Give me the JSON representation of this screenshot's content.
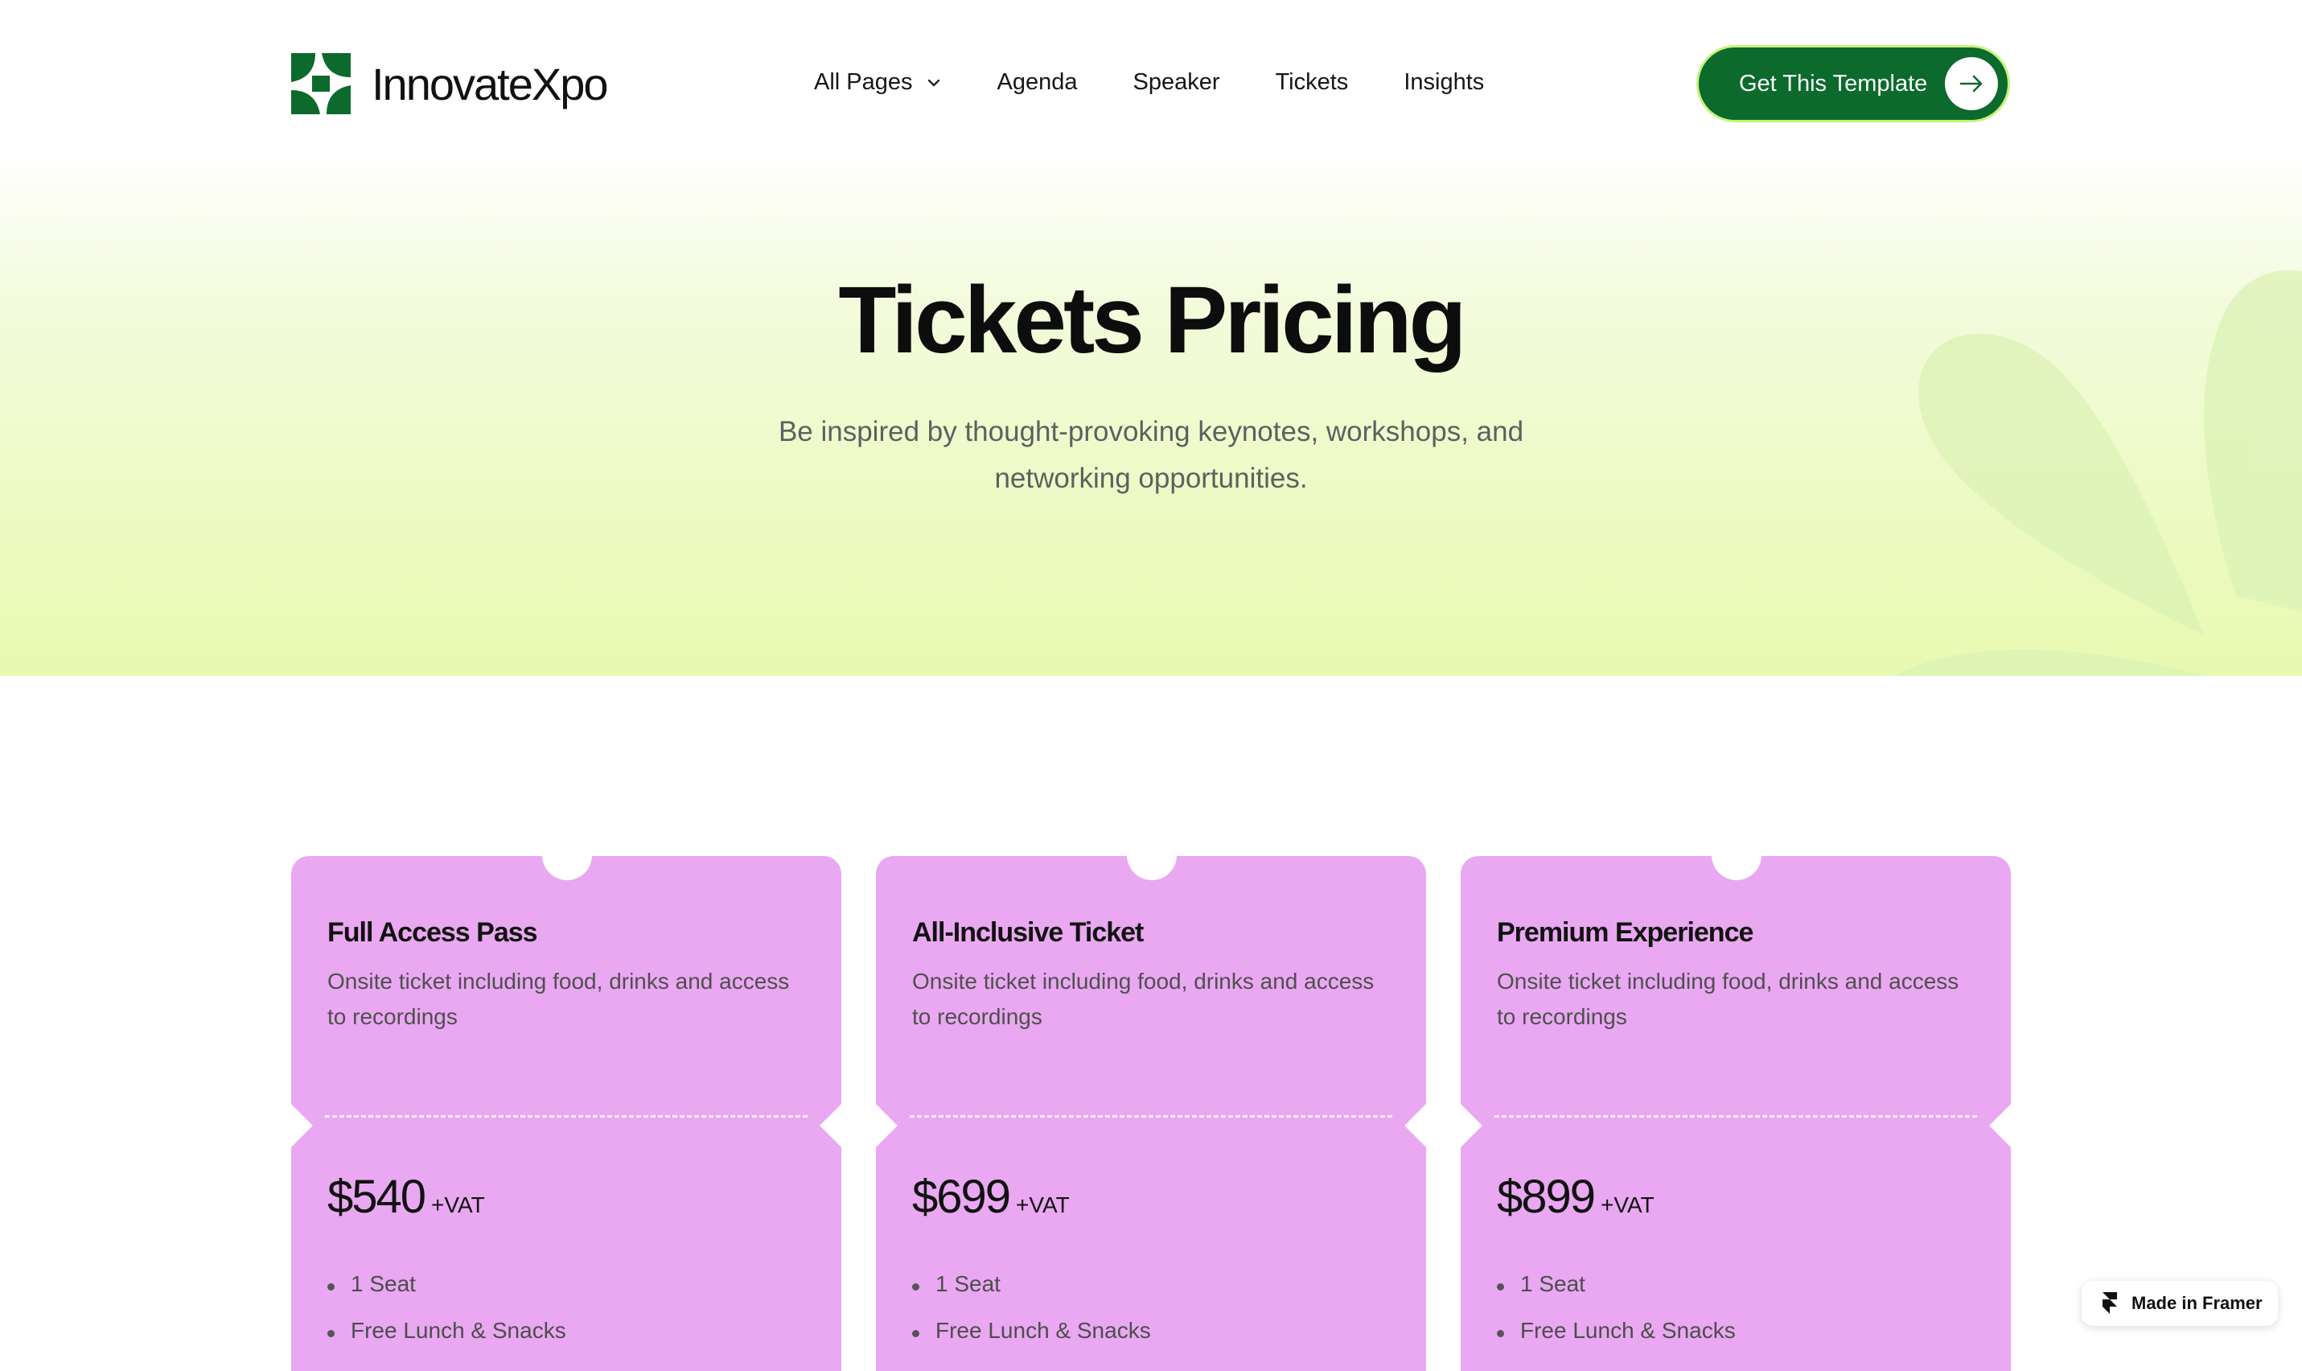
{
  "brand": {
    "name": "InnovateXpo",
    "logo_icon": "pinwheel-logo-icon",
    "color": "#0b6a2c"
  },
  "nav": {
    "items": [
      {
        "label": "All Pages",
        "icon": "chevron-down-icon"
      },
      {
        "label": "Agenda"
      },
      {
        "label": "Speaker"
      },
      {
        "label": "Tickets"
      },
      {
        "label": "Insights"
      }
    ]
  },
  "cta": {
    "label": "Get This Template",
    "icon": "arrow-right-icon",
    "bg": "#0b6a2c",
    "border": "#c6f27b"
  },
  "hero": {
    "title": "Tickets Pricing",
    "subtitle": "Be inspired by thought-provoking keynotes, workshops, and networking opportunities."
  },
  "cards": [
    {
      "title": "Full Access Pass",
      "description": "Onsite ticket including food, drinks and access to recordings",
      "price": "$540",
      "vat": "+VAT",
      "features": [
        "1 Seat",
        "Free Lunch & Snacks"
      ]
    },
    {
      "title": "All-Inclusive Ticket",
      "description": "Onsite ticket including food, drinks and access to recordings",
      "price": "$699",
      "vat": "+VAT",
      "features": [
        "1 Seat",
        "Free Lunch & Snacks"
      ]
    },
    {
      "title": "Premium Experience",
      "description": "Onsite ticket including food, drinks and access to recordings",
      "price": "$899",
      "vat": "+VAT",
      "features": [
        "1 Seat",
        "Free Lunch & Snacks"
      ]
    }
  ],
  "card_color": "#e9a8f1",
  "framer_badge": {
    "label": "Made in Framer",
    "icon": "framer-icon"
  }
}
